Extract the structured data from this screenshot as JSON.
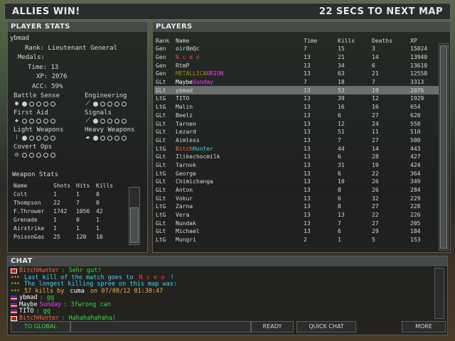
{
  "topbar": {
    "left": "ALLIES WIN!",
    "right": "22 SECS TO NEXT MAP"
  },
  "player_stats": {
    "header": "PLAYER STATS",
    "name": "ybmad",
    "rank_label": "Rank:",
    "rank_value": "Lieutenant General",
    "medals_label": "Medals:",
    "time_label": "Time:",
    "time_value": "13",
    "xp_label": "XP:",
    "xp_value": "2076",
    "acc_label": "ACC:",
    "acc_value": "59%",
    "skills": [
      {
        "name": "Battle Sense",
        "icon": "eye-icon",
        "level": 1
      },
      {
        "name": "Engineering",
        "icon": "wrench-icon",
        "level": 1
      },
      {
        "name": "First Aid",
        "icon": "cross-icon",
        "level": 0
      },
      {
        "name": "Signals",
        "icon": "pen-icon",
        "level": 1
      },
      {
        "name": "Light Weapons",
        "icon": "bullet-icon",
        "level": 1
      },
      {
        "name": "Heavy Weapons",
        "icon": "gun-icon",
        "level": 1
      },
      {
        "name": "Covert Ops",
        "icon": "target-icon",
        "level": 0
      }
    ],
    "weapon_stats": {
      "title": "Weapon Stats",
      "columns": [
        "Name",
        "Shots",
        "Hits",
        "Kills"
      ],
      "rows": [
        [
          "Colt",
          "1",
          "1",
          "0"
        ],
        [
          "Thompson",
          "22",
          "7",
          "0"
        ],
        [
          "F.Thrower",
          "1742",
          "1056",
          "42"
        ],
        [
          "Grenade",
          "1",
          "0",
          "1"
        ],
        [
          "Airstrike",
          "1",
          "1",
          "1"
        ],
        [
          "PoisonGas",
          "25",
          "120",
          "10"
        ]
      ]
    }
  },
  "players": {
    "header": "PLAYERS",
    "columns": [
      "Rank",
      "Name",
      "Time",
      "Kills",
      "Deaths",
      "XP"
    ],
    "rows": [
      {
        "rank": "Gen",
        "name": "oir8mQc",
        "time": "7",
        "kills": "15",
        "deaths": "3",
        "xp": "15824"
      },
      {
        "rank": "Gen",
        "name": "N c e o",
        "time": "13",
        "kills": "21",
        "deaths": "14",
        "xp": "13940"
      },
      {
        "rank": "Gen",
        "name": "RtmP",
        "time": "13",
        "kills": "34",
        "deaths": "6",
        "xp": "13610"
      },
      {
        "rank": "Gen",
        "name": "METALLICAORION",
        "time": "13",
        "kills": "63",
        "deaths": "21",
        "xp": "12558"
      },
      {
        "rank": "GLt",
        "name": "MaybeSunday",
        "time": "7",
        "kills": "18",
        "deaths": "7",
        "xp": "3313"
      },
      {
        "rank": "GLt",
        "name": "ybmad",
        "time": "13",
        "kills": "53",
        "deaths": "19",
        "xp": "2076"
      },
      {
        "rank": "LtG",
        "name": "TITO",
        "time": "13",
        "kills": "39",
        "deaths": "12",
        "xp": "1929"
      },
      {
        "rank": "LtG",
        "name": "Malin",
        "time": "13",
        "kills": "16",
        "deaths": "16",
        "xp": "654"
      },
      {
        "rank": "GLt",
        "name": "Beelz",
        "time": "13",
        "kills": "6",
        "deaths": "27",
        "xp": "620"
      },
      {
        "rank": "GLt",
        "name": "Tarnen",
        "time": "13",
        "kills": "12",
        "deaths": "24",
        "xp": "558"
      },
      {
        "rank": "GLt",
        "name": "Lezard",
        "time": "13",
        "kills": "51",
        "deaths": "11",
        "xp": "510"
      },
      {
        "rank": "GLt",
        "name": "Aimless",
        "time": "13",
        "kills": "7",
        "deaths": "27",
        "xp": "500"
      },
      {
        "rank": "LtG",
        "name": "BitchHunter",
        "time": "13",
        "kills": "44",
        "deaths": "14",
        "xp": "443"
      },
      {
        "rank": "GLt",
        "name": "Ilikechocmilk",
        "time": "13",
        "kills": "6",
        "deaths": "28",
        "xp": "427"
      },
      {
        "rank": "GLt",
        "name": "Tarnok",
        "time": "13",
        "kills": "31",
        "deaths": "19",
        "xp": "424"
      },
      {
        "rank": "LtG",
        "name": "George",
        "time": "13",
        "kills": "6",
        "deaths": "22",
        "xp": "364"
      },
      {
        "rank": "GLt",
        "name": "Chimichanga",
        "time": "13",
        "kills": "10",
        "deaths": "26",
        "xp": "349"
      },
      {
        "rank": "GLt",
        "name": "Anton",
        "time": "13",
        "kills": "8",
        "deaths": "26",
        "xp": "284"
      },
      {
        "rank": "GLt",
        "name": "Vokur",
        "time": "13",
        "kills": "6",
        "deaths": "32",
        "xp": "229"
      },
      {
        "rank": "LtG",
        "name": "Zarna",
        "time": "13",
        "kills": "8",
        "deaths": "27",
        "xp": "228"
      },
      {
        "rank": "LtG",
        "name": "Vera",
        "time": "13",
        "kills": "13",
        "deaths": "22",
        "xp": "226"
      },
      {
        "rank": "GLt",
        "name": "Nundak",
        "time": "13",
        "kills": "7",
        "deaths": "27",
        "xp": "205"
      },
      {
        "rank": "GLt",
        "name": "Michael",
        "time": "13",
        "kills": "6",
        "deaths": "29",
        "xp": "184"
      },
      {
        "rank": "LtG",
        "name": "Mungri",
        "time": "2",
        "kills": "1",
        "deaths": "5",
        "xp": "153"
      }
    ]
  },
  "chat": {
    "header": "CHAT",
    "lines": [
      {
        "flag": "axis",
        "parts": [
          {
            "t": "BitchHunter",
            "c": "#ff6a3a"
          },
          {
            "t": ": Sehr gut!",
            "c": "#3adf3a"
          }
        ]
      },
      {
        "flag": "stars",
        "parts": [
          {
            "t": "Last kill of the match goes to ",
            "c": "#3ad8ff"
          },
          {
            "t": "N c e o",
            "c": "#ff3a3a"
          },
          {
            "t": " !",
            "c": "#3ad8ff"
          }
        ]
      },
      {
        "flag": "stars",
        "parts": [
          {
            "t": "The longest killing spree on this map was:",
            "c": "#3ad8ff"
          }
        ]
      },
      {
        "flag": "stars",
        "parts": [
          {
            "t": "57 kills by ",
            "c": "#ffae3a"
          },
          {
            "t": "cuma",
            "c": "#ffffff"
          },
          {
            "t": " on 07/08/12 01:30:47",
            "c": "#ffae3a"
          }
        ]
      },
      {
        "flag": "allies",
        "parts": [
          {
            "t": "ybmad",
            "c": "#ffffff"
          },
          {
            "t": ": gg",
            "c": "#3adf3a"
          }
        ]
      },
      {
        "flag": "allies",
        "parts": [
          {
            "t": "Maybe",
            "c": "#ffffff"
          },
          {
            "t": "Sunday",
            "c": "#ff3aff"
          },
          {
            "t": ": 3fwrong can",
            "c": "#3adf3a"
          }
        ]
      },
      {
        "flag": "allies",
        "parts": [
          {
            "t": "TITO",
            "c": "#ffffff"
          },
          {
            "t": ": gg",
            "c": "#3adf3a"
          }
        ]
      },
      {
        "flag": "axis",
        "parts": [
          {
            "t": "BitchHunter",
            "c": "#ff6a3a"
          },
          {
            "t": ": Hahahahahaha!",
            "c": "#3adf3a"
          }
        ]
      }
    ]
  },
  "buttons": {
    "to_global": "TO GLOBAL",
    "ready": "READY",
    "quick_chat": "QUICK CHAT",
    "more": "MORE"
  },
  "colors": {
    "panel_bg": "#1c1e1e",
    "header_bg": "#454948",
    "selected_row": "#6a6e6c",
    "green": "#3adf3a"
  }
}
